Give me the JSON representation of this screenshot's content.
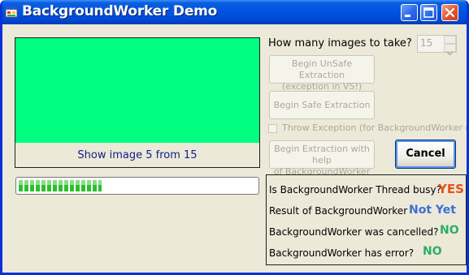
{
  "window": {
    "title": "BackgroundWorker Demo",
    "icon": "app-icon"
  },
  "image_panel": {
    "caption": "Show image 5 from 15",
    "fill_color": "#00ff80"
  },
  "progress": {
    "value_percent": 35
  },
  "controls": {
    "images_question": "How many images to take?",
    "images_count": "15",
    "unsafe_button": "Begin UnSafe Extraction\n(exception in VS!)",
    "safe_button": "Begin Safe Extraction",
    "throw_checkbox_label": "Throw Exception (for BackgroundWorker only)",
    "throw_checkbox_checked": false,
    "help_button": "Begin Extraction with help\nof  BackgroundWorker",
    "cancel_button": "Cancel"
  },
  "status": {
    "busy_q": "Is BackgroundWorker Thread busy?",
    "busy_a": "YES",
    "busy_color": "#e8501a",
    "result_q": "Result of BackgroundWorker",
    "result_a": "Not Yet",
    "result_color": "#3b6fd6",
    "cancelled_q": "BackgroundWorker was cancelled?",
    "cancelled_a": "NO",
    "cancelled_color": "#2fae62",
    "error_q": "BackgroundWorker has error?",
    "error_a": "NO",
    "error_color": "#2fae62"
  }
}
